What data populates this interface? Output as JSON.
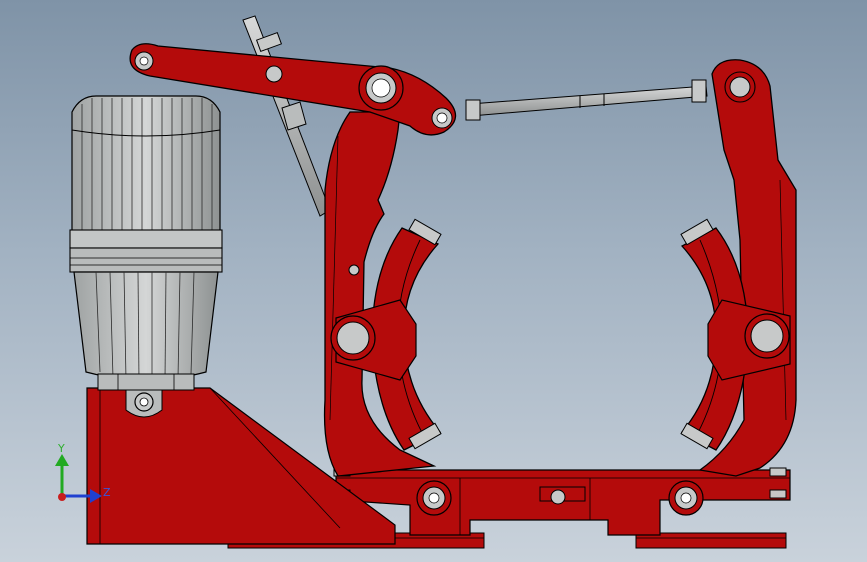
{
  "viewport": {
    "background_top": "#7f93a7",
    "background_bottom": "#c9d2db"
  },
  "model": {
    "part_color": "#b40b0b",
    "outline_color": "#000000",
    "metal_color": "#b9bcbc",
    "pin_color": "#c7c9c9"
  },
  "triad": {
    "y_label": "Y",
    "z_label": "Z",
    "y_color": "#22aa22",
    "z_color": "#2040d0",
    "x_color": "#c81e1e"
  }
}
